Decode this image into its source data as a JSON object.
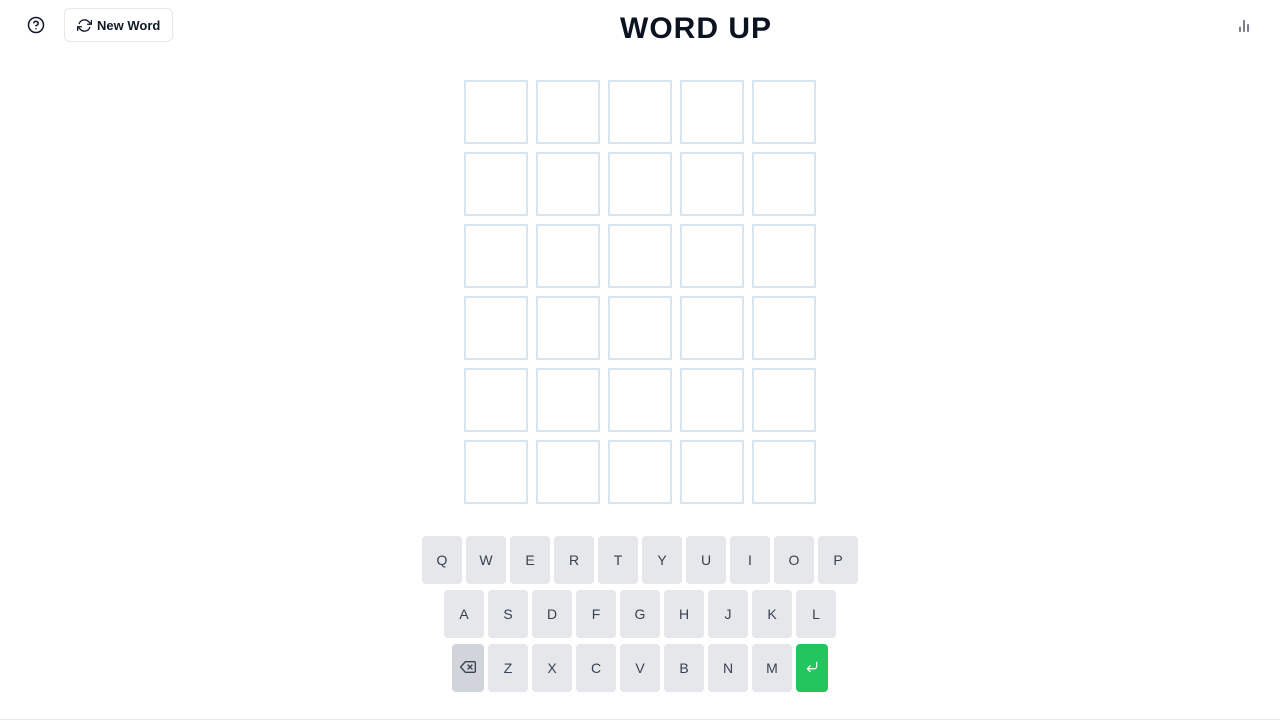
{
  "header": {
    "title": "WORD UP",
    "new_word_label": "New Word",
    "help_icon": "help-circle-icon",
    "new_word_icon": "refresh-icon",
    "stats_icon": "bar-chart-icon"
  },
  "board": {
    "rows": 6,
    "cols": 5,
    "tiles": [
      [
        "",
        "",
        "",
        "",
        ""
      ],
      [
        "",
        "",
        "",
        "",
        ""
      ],
      [
        "",
        "",
        "",
        "",
        ""
      ],
      [
        "",
        "",
        "",
        "",
        ""
      ],
      [
        "",
        "",
        "",
        "",
        ""
      ],
      [
        "",
        "",
        "",
        "",
        ""
      ]
    ],
    "empty_border_color": "#d7e6f0"
  },
  "keyboard": {
    "row1": [
      "Q",
      "W",
      "E",
      "R",
      "T",
      "Y",
      "U",
      "I",
      "O",
      "P"
    ],
    "row2": [
      "A",
      "S",
      "D",
      "F",
      "G",
      "H",
      "J",
      "K",
      "L"
    ],
    "row3": [
      "Z",
      "X",
      "C",
      "V",
      "B",
      "N",
      "M"
    ],
    "backspace_icon": "backspace-icon",
    "enter_icon": "enter-icon",
    "key_color": "#e5e7eb",
    "enter_color": "#22c55e"
  }
}
